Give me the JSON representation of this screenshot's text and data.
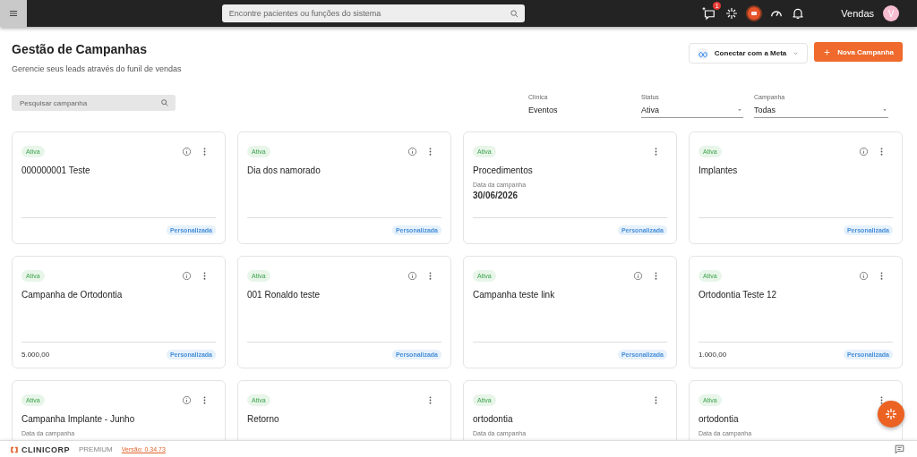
{
  "topbar": {
    "search_placeholder": "Encontre pacientes ou funções do sistema",
    "notification_count": "1",
    "user_name": "Vendas",
    "avatar_initial": "V"
  },
  "header": {
    "title": "Gestão de Campanhas",
    "subtitle": "Gerencie seus leads através do funil de vendas",
    "meta_button": "Conectar com a Meta",
    "new_button": "Nova Campanha"
  },
  "filters": {
    "search_placeholder": "Pesquisar campanha",
    "fields": [
      {
        "label": "Clínica",
        "value": "Eventos",
        "dropdown": false
      },
      {
        "label": "Status",
        "value": "Ativa",
        "dropdown": true
      },
      {
        "label": "Campanha",
        "value": "Todas",
        "dropdown": true
      }
    ]
  },
  "campaigns": [
    {
      "status": "Ativa",
      "info": true,
      "title": "000000001 Teste",
      "tag": "Personalizada"
    },
    {
      "status": "Ativa",
      "info": true,
      "title": "Dia dos namorado",
      "tag": "Personalizada"
    },
    {
      "status": "Ativa",
      "info": false,
      "title": "Procedimentos",
      "date_label": "Data da campanha",
      "date": "30/06/2026",
      "tag": "Personalizada"
    },
    {
      "status": "Ativa",
      "info": true,
      "title": "Implantes",
      "tag": "Personalizada"
    },
    {
      "status": "Ativa",
      "info": true,
      "title": "Campanha de Ortodontia",
      "value": "5.000,00",
      "tag": "Personalizada"
    },
    {
      "status": "Ativa",
      "info": true,
      "title": "001 Ronaldo teste",
      "tag": "Personalizada"
    },
    {
      "status": "Ativa",
      "info": true,
      "title": "Campanha teste link",
      "tag": "Personalizada"
    },
    {
      "status": "Ativa",
      "info": true,
      "title": "Ortodontia Teste 12",
      "value": "1.000,00",
      "tag": "Personalizada"
    },
    {
      "status": "Ativa",
      "info": true,
      "title": "Campanha Implante - Junho",
      "date_label": "Data da campanha"
    },
    {
      "status": "Ativa",
      "info": false,
      "title": "Retorno"
    },
    {
      "status": "Ativa",
      "info": false,
      "title": "ortodontia",
      "date_label": "Data da campanha"
    },
    {
      "status": "Ativa",
      "info": false,
      "title": "ortodontia",
      "date_label": "Data da campanha"
    }
  ],
  "footer": {
    "brand": "CLINICORP",
    "plan": "PREMIUM",
    "version": "Versão: 0.34.73"
  }
}
